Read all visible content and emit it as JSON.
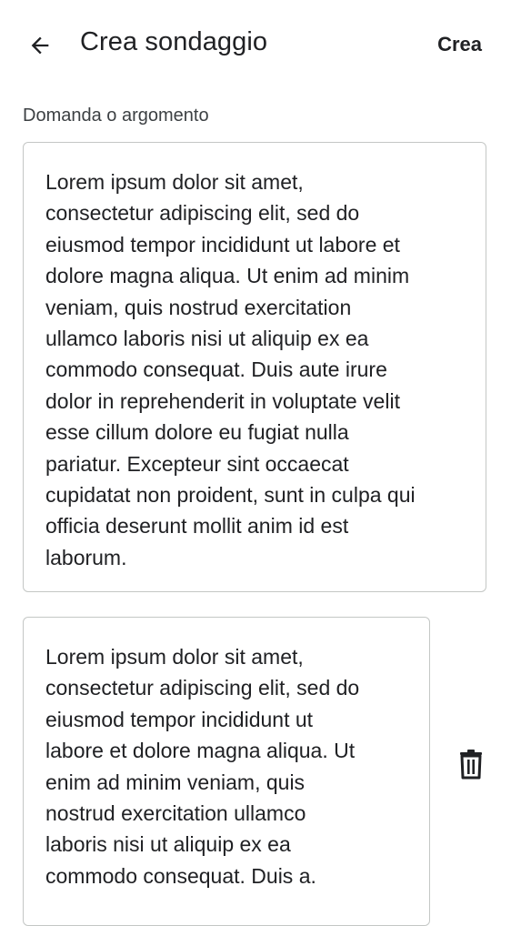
{
  "header": {
    "title": "Crea sondaggio",
    "create_label": "Crea",
    "back_icon": "arrow-back-icon"
  },
  "question": {
    "label": "Domanda o argomento",
    "value": "Lorem ipsum dolor sit amet,\nconsectetur adipiscing elit, sed do\neiusmod tempor incididunt ut labore et\ndolore magna aliqua. Ut enim ad minim\nveniam, quis nostrud exercitation\nullamco laboris nisi ut aliquip ex ea\ncommodo consequat. Duis aute irure\ndolor in reprehenderit in voluptate velit\nesse cillum dolore eu fugiat nulla\npariatur. Excepteur sint occaecat\ncupidatat non proident, sunt in culpa qui\nofficia deserunt mollit anim id est\nlaborum."
  },
  "options": [
    {
      "value": "Lorem ipsum dolor sit amet,\nconsectetur adipiscing elit, sed do\neiusmod tempor incididunt ut\nlabore et dolore magna aliqua. Ut\nenim ad minim veniam, quis\nnostrud exercitation ullamco\nlaboris nisi ut aliquip ex ea\ncommodo consequat. Duis a.",
      "delete_icon": "trash-icon"
    }
  ],
  "colors": {
    "text": "#202124",
    "border": "#c4c7c5"
  }
}
